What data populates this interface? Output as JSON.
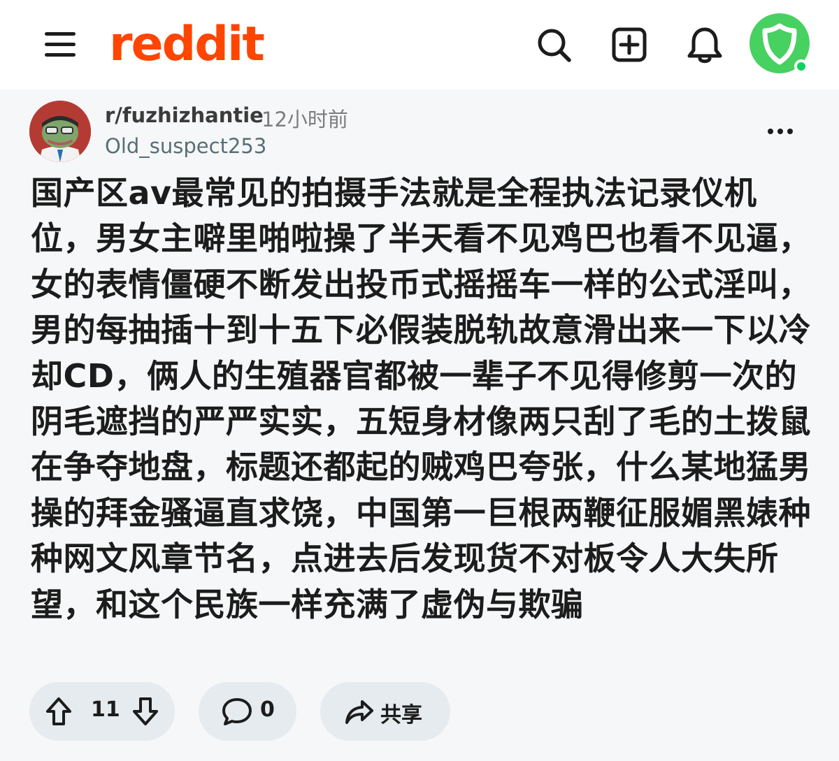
{
  "header": {
    "logo_text": "reddit",
    "icons": [
      "menu-icon",
      "search-icon",
      "create-post-icon",
      "notification-bell-icon",
      "user-avatar-icon"
    ],
    "brand_color": "#ff4500",
    "avatar_color": "#46d160"
  },
  "post": {
    "subreddit": "r/fuzhizhantie",
    "time_ago": "12小时前",
    "author": "Old_suspect253",
    "body": "国产区av最常见的拍摄手法就是全程执法记录仪机位，男女主噼里啪啦操了半天看不见鸡巴也看不见逼，女的表情僵硬不断发出投币式摇摇车一样的公式淫叫，男的每抽插十到十五下必假装脱轨故意滑出来一下以冷却CD，俩人的生殖器官都被一辈子不见得修剪一次的阴毛遮挡的严严实实，五短身材像两只刮了毛的土拨鼠在争夺地盘，标题还都起的贼鸡巴夸张，什么某地猛男操的拜金骚逼直求饶，中国第一巨根两鞭征服媚黑婊种种网文风章节名，点进去后发现货不对板令人大失所望，和这个民族一样充满了虚伪与欺骗"
  },
  "actions": {
    "vote_count": "11",
    "comment_count": "0",
    "share_label": "共享",
    "pill_color": "#e5ebee"
  }
}
